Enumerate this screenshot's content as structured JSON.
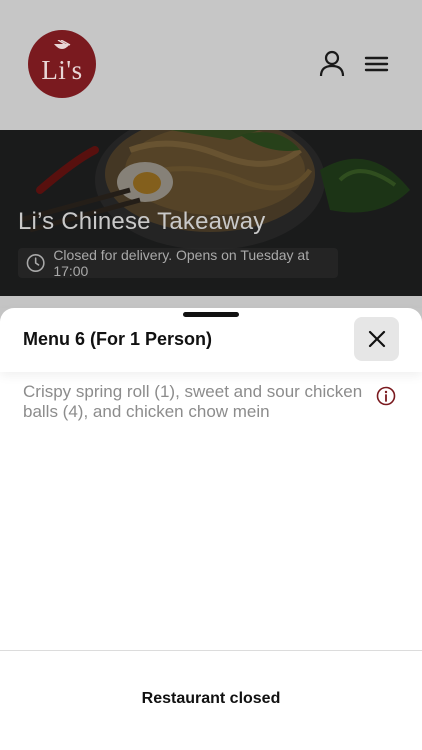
{
  "header": {
    "logo_text": "Li's",
    "user_icon": "user-icon",
    "menu_icon": "hamburger-menu-icon"
  },
  "hero": {
    "restaurant_name": "Li’s Chinese Takeaway",
    "status_icon": "clock-icon",
    "status_text": "Closed for delivery. Opens on Tuesday at 17:00"
  },
  "sheet": {
    "title": "Menu 6 (For 1 Person)",
    "close_icon": "close-icon",
    "description": "Crispy spring roll (1), sweet and sour chicken balls (4), and chicken chow mein",
    "info_icon": "info-icon",
    "footer_label": "Restaurant closed"
  },
  "colors": {
    "brand": "#7a1a1f",
    "header_bg": "#c6c6c6",
    "close_bg": "#e6e6e6",
    "description": "#8c8c8c"
  }
}
